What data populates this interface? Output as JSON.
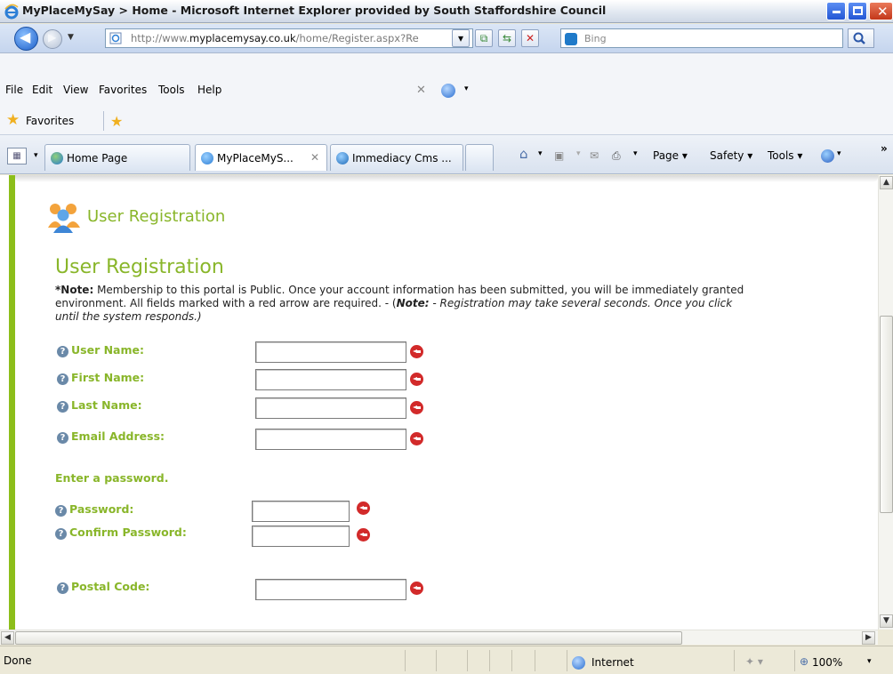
{
  "window": {
    "title": "MyPlaceMySay > Home - Microsoft Internet Explorer provided by South Staffordshire Council"
  },
  "address": {
    "url_prefix": "http://www.",
    "url_domain": "myplacemysay.co.uk",
    "url_path": "/home/Register.aspx?Re"
  },
  "search": {
    "placeholder": "Bing"
  },
  "menu": {
    "items": [
      "File",
      "Edit",
      "View",
      "Favorites",
      "Tools",
      "Help"
    ]
  },
  "favorites": {
    "label": "Favorites"
  },
  "tabs": [
    {
      "label": "Home Page"
    },
    {
      "label": "MyPlaceMyS..."
    },
    {
      "label": "Immediacy Cms ..."
    }
  ],
  "commandbar": {
    "page": "Page ▾",
    "safety": "Safety ▾",
    "tools": "Tools ▾",
    "more": "»"
  },
  "page": {
    "header": "User Registration",
    "title": "User Registration",
    "note_bold": "*Note:",
    "note_line1": " Membership to this portal is Public. Once your account information has been submitted, you will be immediately granted",
    "note_line2a": "environment. All fields marked with a red arrow are required. - (",
    "note_line2_bold": "Note:",
    "note_line2b": " - Registration may take several seconds. Once you click",
    "note_line3": "until the system responds.)",
    "fields": {
      "username": "User Name:",
      "firstname": "First Name:",
      "lastname": "Last Name:",
      "email": "Email Address:",
      "password": "Password:",
      "confirm": "Confirm Password:",
      "postal": "Postal Code:"
    },
    "password_prompt": "Enter a password."
  },
  "status": {
    "text": "Done",
    "zone": "Internet",
    "zoom": "100%"
  },
  "colors": {
    "accent_green": "#89b62a",
    "left_bar": "#8cbe1a",
    "required_red": "#d22a2a"
  }
}
